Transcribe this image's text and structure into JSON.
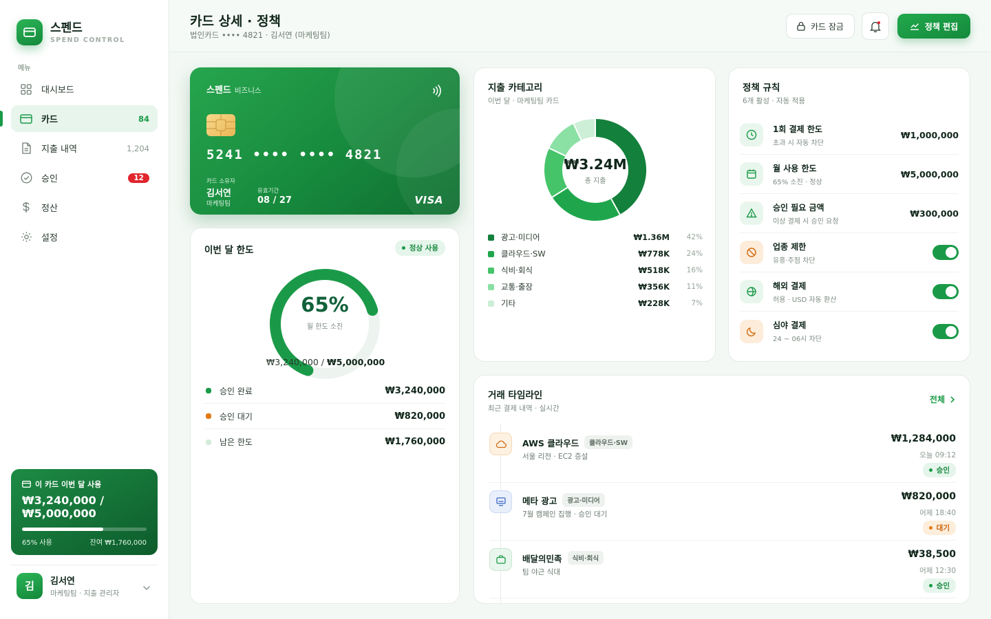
{
  "brand": {
    "name": "스펜드",
    "subtitle": "SPEND CONTROL"
  },
  "sidebar": {
    "menu_label": "메뉴",
    "items": [
      {
        "label": "대시보드",
        "icon": "grid-icon",
        "count": ""
      },
      {
        "label": "카드",
        "icon": "card-icon",
        "count": "84"
      },
      {
        "label": "지출 내역",
        "icon": "document-icon",
        "count": "1,204"
      },
      {
        "label": "승인",
        "icon": "check-circle-icon",
        "badge": "12"
      },
      {
        "label": "정산",
        "icon": "dollar-icon",
        "count": ""
      },
      {
        "label": "설정",
        "icon": "gear-icon",
        "count": ""
      }
    ],
    "usage": {
      "title": "이 카드 이번 달 사용",
      "amount_line1": "₩3,240,000 /",
      "amount_line2": "₩5,000,000",
      "percent": 65,
      "used_label": "65% 사용",
      "remain_label": "잔여 ₩1,760,000"
    },
    "user": {
      "initial": "김",
      "name": "김서연",
      "role": "마케팅팀 · 지출 관리자"
    }
  },
  "header": {
    "title": "카드 상세 · 정책",
    "subtitle": "법인카드 •••• 4821 · 김서연 (마케팅팀)",
    "lock_label": "카드 잠금",
    "edit_label": "정책 편집"
  },
  "card": {
    "brand": "스펜드",
    "tier": "비즈니스",
    "number": "5241 •••• •••• 4821",
    "holder_label": "카드 소유자",
    "holder": "김서연",
    "team": "마케팅팀",
    "expiry_label": "유효기간",
    "expiry": "08 / 27",
    "network": "VISA"
  },
  "limit": {
    "title": "이번 달 한도",
    "status": "정상 사용",
    "percent": 65,
    "percent_label": "65%",
    "caption": "월 한도 소진",
    "used": "₩3,240,000",
    "separator": "/",
    "total": "₩5,000,000",
    "rows": [
      {
        "label": "승인 완료",
        "amount": "₩3,240,000",
        "color": "#1a9a48"
      },
      {
        "label": "승인 대기",
        "amount": "₩820,000",
        "color": "#e07b12"
      },
      {
        "label": "남은 한도",
        "amount": "₩1,760,000",
        "color": "#d4ecdb"
      }
    ]
  },
  "category": {
    "title": "지출 카테고리",
    "subtitle": "이번 달 · 마케팅팀 카드",
    "total": "₩3.24M",
    "total_caption": "총 지출",
    "items": [
      {
        "label": "광고·미디어",
        "amount": "₩1.36M",
        "pct": "42%",
        "value": 42,
        "color": "#13803c"
      },
      {
        "label": "클라우드·SW",
        "amount": "₩778K",
        "pct": "24%",
        "value": 24,
        "color": "#1fa64c"
      },
      {
        "label": "식비·회식",
        "amount": "₩518K",
        "pct": "16%",
        "value": 16,
        "color": "#46c46a"
      },
      {
        "label": "교통·출장",
        "amount": "₩356K",
        "pct": "11%",
        "value": 11,
        "color": "#8be0a3"
      },
      {
        "label": "기타",
        "amount": "₩228K",
        "pct": "7%",
        "value": 7,
        "color": "#cdeed7"
      }
    ]
  },
  "policy": {
    "title": "정책 규칙",
    "subtitle": "6개 활성 · 자동 적용",
    "rules": [
      {
        "name": "1회 결제 한도",
        "desc": "초과 시 자동 차단",
        "value": "₩1,000,000",
        "icon": "clock-icon",
        "tone": "g"
      },
      {
        "name": "월 사용 한도",
        "desc": "65% 소진 · 정상",
        "value": "₩5,000,000",
        "icon": "calendar-icon",
        "tone": "g"
      },
      {
        "name": "승인 필요 금액",
        "desc": "이상 결제 시 승인 요청",
        "value": "₩300,000",
        "icon": "warning-icon",
        "tone": "g"
      },
      {
        "name": "업종 제한",
        "desc": "유흥·주점 차단",
        "toggle": true,
        "icon": "ban-icon",
        "tone": "o"
      },
      {
        "name": "해외 결제",
        "desc": "허용 · USD 자동 환산",
        "toggle": true,
        "icon": "globe-icon",
        "tone": "g"
      },
      {
        "name": "심야 결제",
        "desc": "24 ~ 06시 차단",
        "toggle": true,
        "icon": "moon-icon",
        "tone": "o"
      }
    ]
  },
  "timeline": {
    "title": "거래 타임라인",
    "subtitle": "최근 결제 내역 · 실시간",
    "all_label": "전체",
    "items": [
      {
        "name": "AWS 클라우드",
        "tag": "클라우드·SW",
        "desc": "서울 리전 · EC2 증설",
        "amount": "₩1,284,000",
        "time": "오늘 09:12",
        "status": "승인",
        "status_type": "ok",
        "icon": "cloud-icon",
        "tone": "o"
      },
      {
        "name": "메타 광고",
        "tag": "광고·미디어",
        "desc": "7월 캠페인 집행 · 승인 대기",
        "amount": "₩820,000",
        "time": "어제 18:40",
        "status": "대기",
        "status_type": "wait",
        "icon": "monitor-icon",
        "tone": "b"
      },
      {
        "name": "배달의민족",
        "tag": "식비·회식",
        "desc": "팀 야근 식대",
        "amount": "₩38,500",
        "time": "어제 12:30",
        "status": "승인",
        "status_type": "ok",
        "icon": "bag-icon",
        "tone": "g"
      }
    ]
  }
}
